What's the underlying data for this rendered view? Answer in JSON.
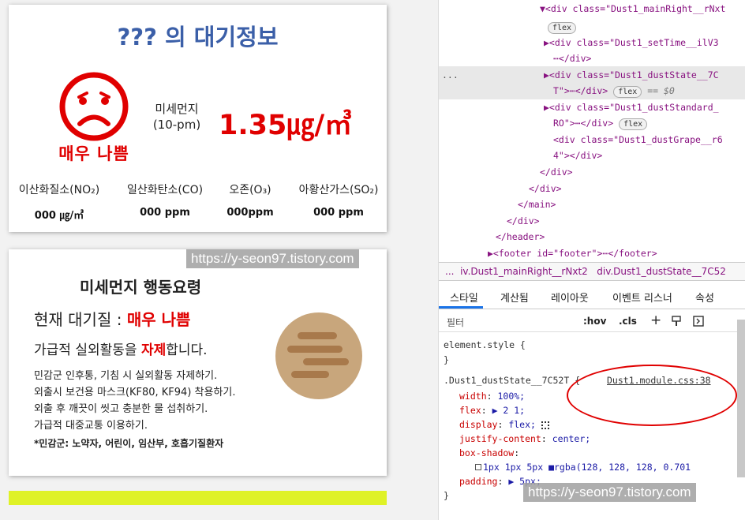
{
  "air": {
    "title": "??? 의 대기정보",
    "state": "매우 나쁨",
    "pm_label1": "미세먼지",
    "pm_label2": "(10-pm)",
    "pm_value": "1.35㎍/㎥",
    "gases": [
      {
        "name": "이산화질소(NO₂)",
        "value": "000 ㎍/㎥"
      },
      {
        "name": "일산화탄소(CO)",
        "value": "000 ppm"
      },
      {
        "name": "오존(O₃)",
        "value": "000ppm"
      },
      {
        "name": "아황산가스(SO₂)",
        "value": "000 ppm"
      }
    ]
  },
  "watermark": "https://y-seon97.tistory.com",
  "action": {
    "title": "미세먼지 행동요령",
    "now_prefix": "현재 대기질 : ",
    "now_state": "매우 나쁨",
    "avoid_pre": "가급적 실외활동을 ",
    "avoid_bold": "자제",
    "avoid_post": "합니다.",
    "lines": [
      "민감군 인후통, 기침 시 실외활동 자제하기.",
      "외출시 보건용 마스크(KF80, KF94) 착용하기.",
      "외출 후 깨끗이 씻고 충분한 물 섭취하기.",
      "가급적 대중교통 이용하기."
    ],
    "note": "*민감군: 노약자, 어린이, 임산부, 호흡기질환자"
  },
  "devtools": {
    "dom": [
      {
        "t": "▼<div class=\"Dust1_mainRight__rNxt",
        "x": 0
      },
      {
        "t": "flex",
        "pill": true
      },
      {
        "t": "▶<div class=\"Dust1_setTime__ilV3",
        "x": 0
      },
      {
        "t": "⋯</div>"
      },
      {
        "t": "▶<div class=\"Dust1_dustState__7C"
      },
      {
        "t": "T\">⋯</div>"
      },
      {
        "t": "▶<div class=\"Dust1_dustStandard_"
      },
      {
        "t": "RO\">⋯</div>"
      },
      {
        "t": "<div class=\"Dust1_dustGrape__r6"
      },
      {
        "t": "4\"></div>"
      },
      {
        "t": "</div>"
      },
      {
        "t": "</div>"
      },
      {
        "t": "</main>"
      },
      {
        "t": "</div>"
      },
      {
        "t": "</header>"
      },
      {
        "t": "▶<footer id=\"footer\">⋯</footer>"
      }
    ],
    "eq_label": "== $0",
    "pill_flex": "flex",
    "dots": "...",
    "breadcrumb_dots": "...",
    "breadcrumb_1": "iv.Dust1_mainRight__rNxt2",
    "breadcrumb_2": "div.Dust1_dustState__7C52",
    "tabs": [
      "스타일",
      "계산됨",
      "레이아웃",
      "이벤트 리스너",
      "속성"
    ],
    "filter_label": "필터",
    "hov": ":hov",
    "cls": ".cls",
    "plus": "+",
    "css": {
      "element_style": "element.style {",
      "close": "}",
      "selector": ".Dust1_dustState__7C52T {",
      "source": "Dust1.module.css:38",
      "props": [
        {
          "p": "width",
          "v": "100%;"
        },
        {
          "p": "flex",
          "v": "▶ 2 1;"
        },
        {
          "p": "display",
          "v": "flex;"
        },
        {
          "p": "justify-content",
          "v": "center;"
        },
        {
          "p": "box-shadow",
          "v": ""
        },
        {
          "p": "",
          "v": "1px 1px 5px ■rgba(128, 128, 128, 0.701"
        },
        {
          "p": "padding",
          "v": "▶ 5px;"
        }
      ]
    }
  },
  "colors": {
    "accent": "#e00000",
    "title_blue": "#3b5fa8",
    "bar": "#dff227"
  }
}
